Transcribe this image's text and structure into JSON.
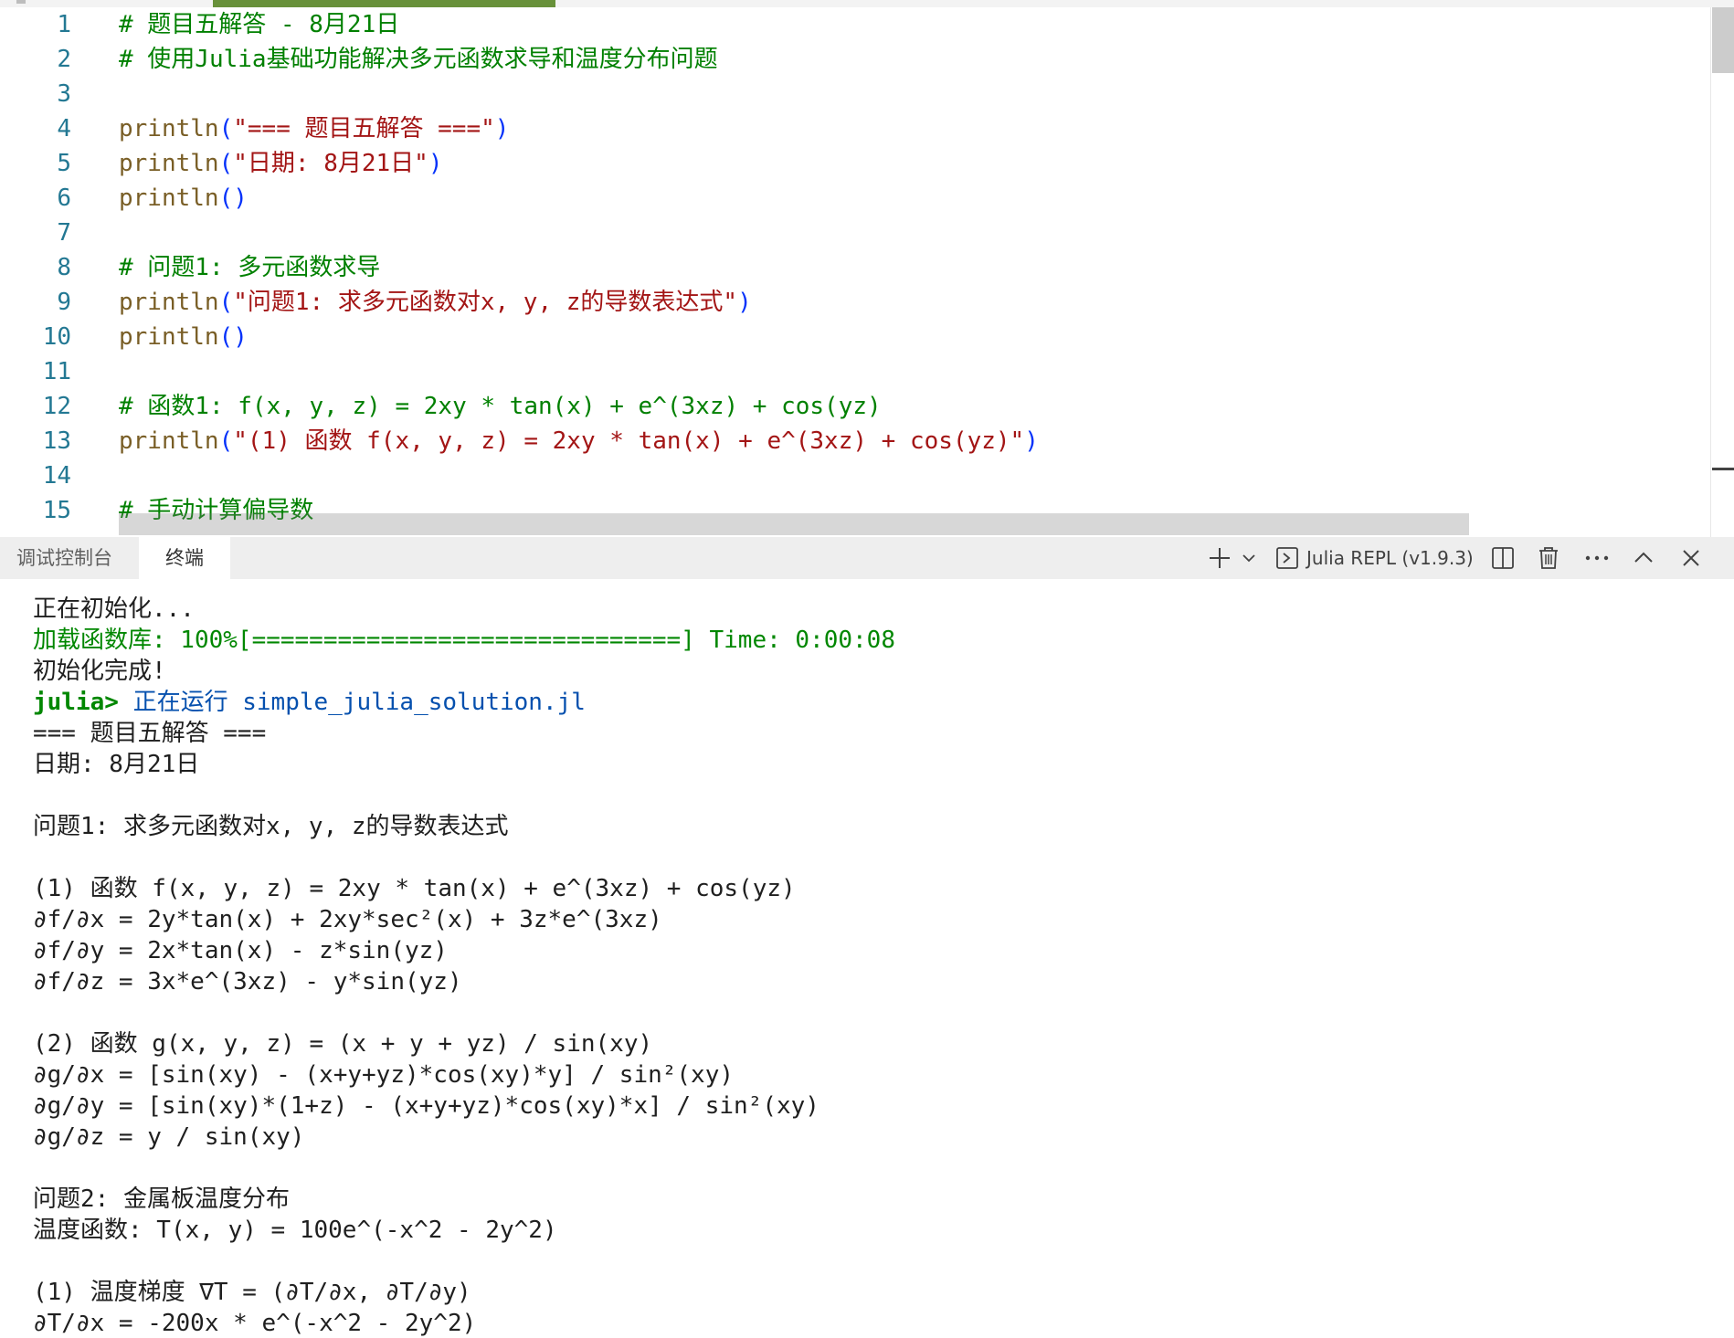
{
  "editor": {
    "lines": [
      {
        "n": "1",
        "parts": [
          {
            "t": "# 题目五解答 - 8月21日",
            "c": "comment"
          }
        ]
      },
      {
        "n": "2",
        "parts": [
          {
            "t": "# 使用Julia基础功能解决多元函数求导和温度分布问题",
            "c": "comment"
          }
        ]
      },
      {
        "n": "3",
        "parts": []
      },
      {
        "n": "4",
        "parts": [
          {
            "t": "println",
            "c": "fn"
          },
          {
            "t": "(",
            "c": "paren"
          },
          {
            "t": "\"=== 题目五解答 ===\"",
            "c": "str"
          },
          {
            "t": ")",
            "c": "paren"
          }
        ]
      },
      {
        "n": "5",
        "parts": [
          {
            "t": "println",
            "c": "fn"
          },
          {
            "t": "(",
            "c": "paren"
          },
          {
            "t": "\"日期: 8月21日\"",
            "c": "str"
          },
          {
            "t": ")",
            "c": "paren"
          }
        ]
      },
      {
        "n": "6",
        "parts": [
          {
            "t": "println",
            "c": "fn"
          },
          {
            "t": "()",
            "c": "paren"
          }
        ]
      },
      {
        "n": "7",
        "parts": []
      },
      {
        "n": "8",
        "parts": [
          {
            "t": "# 问题1: 多元函数求导",
            "c": "comment"
          }
        ]
      },
      {
        "n": "9",
        "parts": [
          {
            "t": "println",
            "c": "fn"
          },
          {
            "t": "(",
            "c": "paren"
          },
          {
            "t": "\"问题1: 求多元函数对x, y, z的导数表达式\"",
            "c": "str"
          },
          {
            "t": ")",
            "c": "paren"
          }
        ]
      },
      {
        "n": "10",
        "parts": [
          {
            "t": "println",
            "c": "fn"
          },
          {
            "t": "()",
            "c": "paren"
          }
        ]
      },
      {
        "n": "11",
        "parts": []
      },
      {
        "n": "12",
        "parts": [
          {
            "t": "# 函数1: f(x, y, z) = 2xy * tan(x) + e^(3xz) + cos(yz)",
            "c": "comment"
          }
        ]
      },
      {
        "n": "13",
        "parts": [
          {
            "t": "println",
            "c": "fn"
          },
          {
            "t": "(",
            "c": "paren"
          },
          {
            "t": "\"(1) 函数 f(x, y, z) = 2xy * tan(x) + e^(3xz) + cos(yz)\"",
            "c": "str"
          },
          {
            "t": ")",
            "c": "paren"
          }
        ]
      },
      {
        "n": "14",
        "parts": []
      },
      {
        "n": "15",
        "parts": [
          {
            "t": "# 手动计算偏导数",
            "c": "comment"
          }
        ]
      }
    ]
  },
  "panel": {
    "tabs": [
      "调试控制台",
      "终端"
    ],
    "active_tab": "终端",
    "terminal_selector": "Julia REPL (v1.9.3)",
    "icons": [
      "plus-icon",
      "chevron-down-icon",
      "terminal-icon",
      "split-terminal-icon",
      "trash-icon",
      "more-icon",
      "chevron-up-icon",
      "close-icon"
    ]
  },
  "terminal": {
    "lines": [
      {
        "parts": [
          {
            "t": "正在初始化...",
            "c": "plain"
          }
        ]
      },
      {
        "parts": [
          {
            "t": "加载函数库: 100%[==============================] Time: 0:00:08",
            "c": "green"
          }
        ]
      },
      {
        "parts": [
          {
            "t": "初始化完成!",
            "c": "plain"
          }
        ]
      },
      {
        "parts": [
          {
            "t": "julia>",
            "c": "prompt"
          },
          {
            "t": " 正在运行 ",
            "c": "blue"
          },
          {
            "t": "simple_julia_solution.jl",
            "c": "blue"
          }
        ]
      },
      {
        "parts": [
          {
            "t": "=== 题目五解答 ===",
            "c": "plain"
          }
        ]
      },
      {
        "parts": [
          {
            "t": "日期: 8月21日",
            "c": "plain"
          }
        ]
      },
      {
        "parts": []
      },
      {
        "parts": [
          {
            "t": "问题1: 求多元函数对x, y, z的导数表达式",
            "c": "plain"
          }
        ]
      },
      {
        "parts": []
      },
      {
        "parts": [
          {
            "t": "(1) 函数 f(x, y, z) = 2xy * tan(x) + e^(3xz) + cos(yz)",
            "c": "plain"
          }
        ]
      },
      {
        "parts": [
          {
            "t": "∂f/∂x = 2y*tan(x) + 2xy*sec²(x) + 3z*e^(3xz)",
            "c": "plain"
          }
        ]
      },
      {
        "parts": [
          {
            "t": "∂f/∂y = 2x*tan(x) - z*sin(yz)",
            "c": "plain"
          }
        ]
      },
      {
        "parts": [
          {
            "t": "∂f/∂z = 3x*e^(3xz) - y*sin(yz)",
            "c": "plain"
          }
        ]
      },
      {
        "parts": []
      },
      {
        "parts": [
          {
            "t": "(2) 函数 g(x, y, z) = (x + y + yz) / sin(xy)",
            "c": "plain"
          }
        ]
      },
      {
        "parts": [
          {
            "t": "∂g/∂x = [sin(xy) - (x+y+yz)*cos(xy)*y] / sin²(xy)",
            "c": "plain"
          }
        ]
      },
      {
        "parts": [
          {
            "t": "∂g/∂y = [sin(xy)*(1+z) - (x+y+yz)*cos(xy)*x] / sin²(xy)",
            "c": "plain"
          }
        ]
      },
      {
        "parts": [
          {
            "t": "∂g/∂z = y / sin(xy)",
            "c": "plain"
          }
        ]
      },
      {
        "parts": []
      },
      {
        "parts": [
          {
            "t": "问题2: 金属板温度分布",
            "c": "plain"
          }
        ]
      },
      {
        "parts": [
          {
            "t": "温度函数: T(x, y) = 100e^(-x^2 - 2y^2)",
            "c": "plain"
          }
        ]
      },
      {
        "parts": []
      },
      {
        "parts": [
          {
            "t": "(1) 温度梯度 ∇T = (∂T/∂x, ∂T/∂y)",
            "c": "plain"
          }
        ]
      },
      {
        "parts": [
          {
            "t": "∂T/∂x = -200x * e^(-x^2 - 2y^2)",
            "c": "plain"
          }
        ]
      }
    ]
  },
  "colors": {
    "comment": "#008000",
    "function": "#795e26",
    "string": "#a31515",
    "paren": "#0431fa",
    "line_number": "#237893",
    "terminal_green": "#008700",
    "terminal_blue": "#0550ae",
    "tab_accent": "#68913a"
  }
}
